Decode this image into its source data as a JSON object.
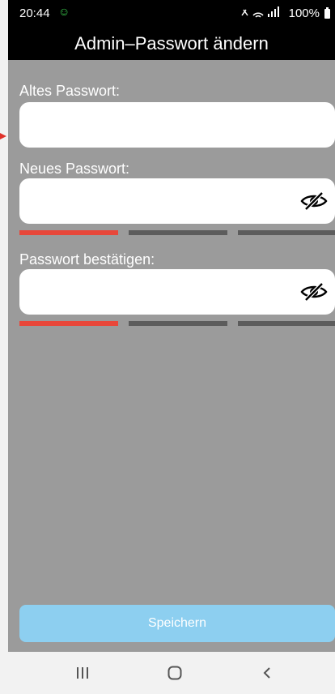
{
  "status_bar": {
    "time": "20:44",
    "battery": "100%"
  },
  "header": {
    "title": "Admin–Passwort ändern"
  },
  "form": {
    "old_password": {
      "label": "Altes Passwort:",
      "value": "",
      "placeholder": ""
    },
    "new_password": {
      "label": "Neues Passwort:",
      "value": "",
      "placeholder": ""
    },
    "confirm_password": {
      "label": "Passwort bestätigen:",
      "value": "",
      "placeholder": ""
    },
    "strength_colors": {
      "active": "#e8473a",
      "inactive": "#5c5c5c"
    }
  },
  "actions": {
    "save_label": "Speichern"
  },
  "colors": {
    "background": "#9b9b9b",
    "save_button": "#8dcff0",
    "header": "#000000"
  },
  "icons": [
    "eye-off-icon",
    "recent-apps-icon",
    "home-icon",
    "back-icon"
  ]
}
